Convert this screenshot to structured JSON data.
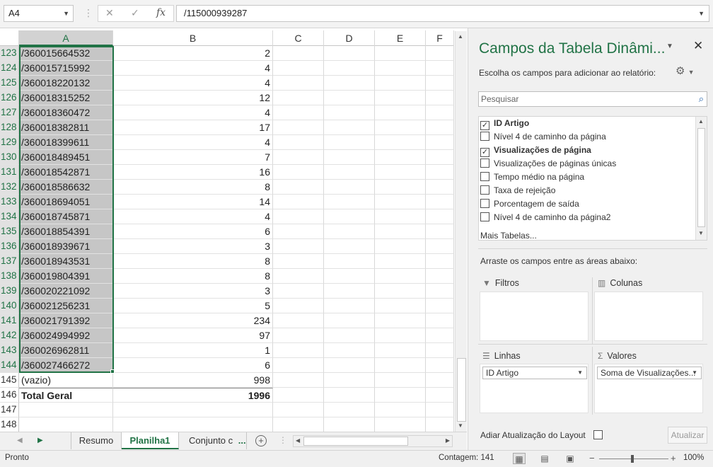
{
  "formula_bar": {
    "name_box": "A4",
    "cancel_icon": "✕",
    "enter_icon": "✓",
    "fx_label": "fx",
    "formula": "/115000939287"
  },
  "columns": [
    "A",
    "B",
    "C",
    "D",
    "E",
    "F"
  ],
  "rows": [
    {
      "num": "123",
      "a": "/360015664532",
      "b": "2"
    },
    {
      "num": "124",
      "a": "/360015715992",
      "b": "4"
    },
    {
      "num": "125",
      "a": "/360018220132",
      "b": "4"
    },
    {
      "num": "126",
      "a": "/360018315252",
      "b": "12"
    },
    {
      "num": "127",
      "a": "/360018360472",
      "b": "4"
    },
    {
      "num": "128",
      "a": "/360018382811",
      "b": "17"
    },
    {
      "num": "129",
      "a": "/360018399611",
      "b": "4"
    },
    {
      "num": "130",
      "a": "/360018489451",
      "b": "7"
    },
    {
      "num": "131",
      "a": "/360018542871",
      "b": "16"
    },
    {
      "num": "132",
      "a": "/360018586632",
      "b": "8"
    },
    {
      "num": "133",
      "a": "/360018694051",
      "b": "14"
    },
    {
      "num": "134",
      "a": "/360018745871",
      "b": "4"
    },
    {
      "num": "135",
      "a": "/360018854391",
      "b": "6"
    },
    {
      "num": "136",
      "a": "/360018939671",
      "b": "3"
    },
    {
      "num": "137",
      "a": "/360018943531",
      "b": "8"
    },
    {
      "num": "138",
      "a": "/360019804391",
      "b": "8"
    },
    {
      "num": "139",
      "a": "/360020221092",
      "b": "3"
    },
    {
      "num": "140",
      "a": "/360021256231",
      "b": "5"
    },
    {
      "num": "141",
      "a": "/360021791392",
      "b": "234"
    },
    {
      "num": "142",
      "a": "/360024994992",
      "b": "97"
    },
    {
      "num": "143",
      "a": "/360026962811",
      "b": "1"
    },
    {
      "num": "144",
      "a": "/360027466272",
      "b": "6"
    },
    {
      "num": "145",
      "a": "(vazio)",
      "b": "998"
    },
    {
      "num": "146",
      "a": "Total Geral",
      "b": "1996"
    },
    {
      "num": "147",
      "a": "",
      "b": ""
    },
    {
      "num": "148",
      "a": "",
      "b": ""
    }
  ],
  "sheet_tabs": [
    "Resumo",
    "Planilha1",
    "Conjunto c"
  ],
  "sheet_tabs_more": "...",
  "active_sheet": "Planilha1",
  "pivot": {
    "title": "Campos da Tabela Dinâmi...",
    "subtitle": "Escolha os campos para adicionar ao relatório:",
    "search_placeholder": "Pesquisar",
    "fields": [
      {
        "label": "ID Artigo",
        "checked": true
      },
      {
        "label": "Nível 4 de caminho da página",
        "checked": false
      },
      {
        "label": "Visualizações de página",
        "checked": true
      },
      {
        "label": "Visualizações de páginas únicas",
        "checked": false
      },
      {
        "label": "Tempo médio na página",
        "checked": false
      },
      {
        "label": "Taxa de rejeição",
        "checked": false
      },
      {
        "label": "Porcentagem de saída",
        "checked": false
      },
      {
        "label": "Nível 4 de caminho da página2",
        "checked": false
      }
    ],
    "more_tables": "Mais Tabelas...",
    "drag_hint": "Arraste os campos entre as áreas abaixo:",
    "areas": {
      "filters": "Filtros",
      "columns": "Colunas",
      "rows": "Linhas",
      "values": "Valores",
      "rows_item": "ID Artigo",
      "values_item": "Soma de Visualizações..."
    },
    "defer_label": "Adiar Atualização do Layout",
    "update_button": "Atualizar"
  },
  "status_bar": {
    "ready": "Pronto",
    "count": "Contagem: 141",
    "zoom": "100%"
  },
  "colors": {
    "accent": "#217346",
    "selection": "#c6c6c6"
  }
}
